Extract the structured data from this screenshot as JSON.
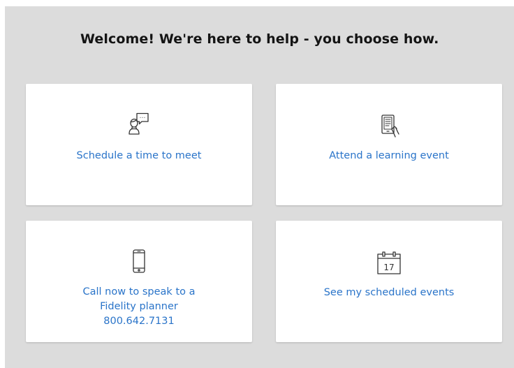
{
  "page": {
    "heading": "Welcome! We're here to help - you choose how."
  },
  "colors": {
    "background_panel": "#dcdcdc",
    "card": "#ffffff",
    "link": "#2a74c9",
    "heading": "#141414",
    "icon_stroke": "#333333"
  },
  "cards": [
    {
      "icon": "person-chat-icon",
      "lines": [
        "Schedule a time to meet"
      ]
    },
    {
      "icon": "ebook-tablet-icon",
      "lines": [
        "Attend a learning event"
      ]
    },
    {
      "icon": "phone-icon",
      "lines": [
        "Call now to speak to a",
        "Fidelity planner",
        "800.642.7131"
      ]
    },
    {
      "icon": "calendar-icon",
      "lines": [
        "See my scheduled events"
      ],
      "calendar_day": "17"
    }
  ]
}
